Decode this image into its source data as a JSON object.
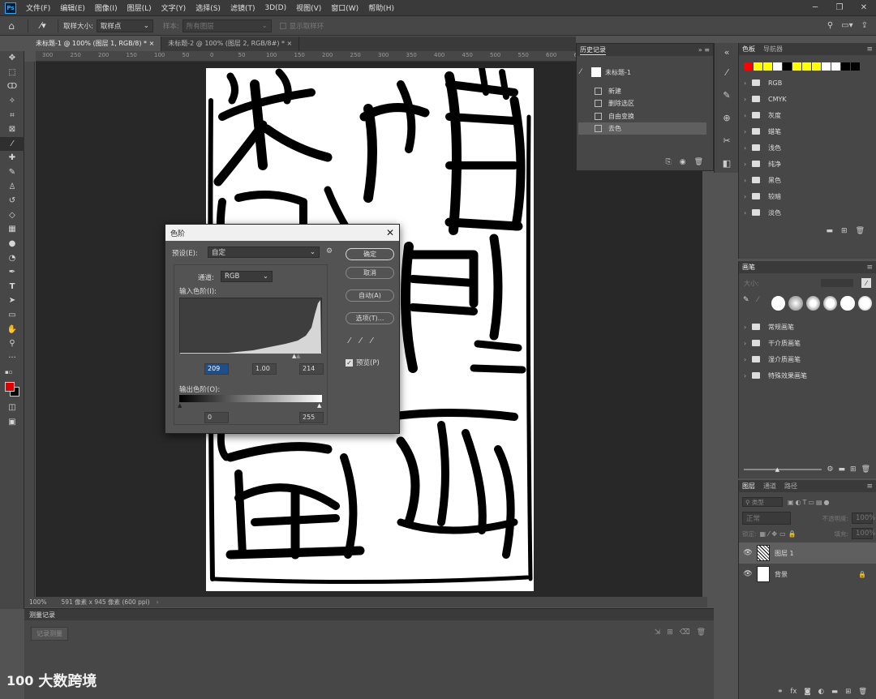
{
  "menu": {
    "logo": "Ps",
    "items": [
      "文件(F)",
      "编辑(E)",
      "图像(I)",
      "图层(L)",
      "文字(Y)",
      "选择(S)",
      "滤镜(T)",
      "3D(D)",
      "视图(V)",
      "窗口(W)",
      "帮助(H)"
    ]
  },
  "options": {
    "sample_size_label": "取样大小:",
    "sample_size_value": "取样点",
    "sample_label": "样本:",
    "sample_value": "所有图层",
    "show_ring": "显示取样环"
  },
  "tabs": [
    {
      "label": "未标题-1 @ 100% (图层 1, RGB/8) *"
    },
    {
      "label": "未标题-2 @ 100% (图层 2, RGB/8#) *"
    }
  ],
  "ruler": {
    "h_ticks": [
      "300",
      "250",
      "200",
      "150",
      "100",
      "50",
      "0",
      "50",
      "100",
      "150",
      "200",
      "250",
      "300",
      "350",
      "400",
      "450",
      "500",
      "550",
      "600",
      "650"
    ]
  },
  "status": {
    "zoom": "100%",
    "doc_info": "591 像素 x 945 像素 (600 ppi)",
    "arrow": "›"
  },
  "measure_log": {
    "title": "测量记录",
    "record_button": "记录测量"
  },
  "history": {
    "title": "历史记录",
    "snapshot": "未标题-1",
    "items": [
      {
        "label": "新建",
        "selected": false
      },
      {
        "label": "删除选区",
        "selected": false
      },
      {
        "label": "自由变换",
        "selected": false
      },
      {
        "label": "去色",
        "selected": true
      }
    ]
  },
  "swatches": {
    "tabs": [
      "色板",
      "导航器"
    ],
    "colors": [
      "#ff0000",
      "#ffff00",
      "#ffff00",
      "#ffffff",
      "#000000",
      "#ffff00",
      "#ffff00",
      "#ffff00",
      "#ffffff",
      "#ffffff",
      "#000000",
      "#000000"
    ],
    "groups": [
      "RGB",
      "CMYK",
      "灰度",
      "蜡笔",
      "浅色",
      "纯净",
      "黑色",
      "较暗",
      "淡色"
    ]
  },
  "brushes": {
    "tab": "画笔",
    "size_label": "大小:",
    "groups": [
      "常规画笔",
      "干介质画笔",
      "湿介质画笔",
      "特殊效果画笔"
    ]
  },
  "layers": {
    "tabs": [
      "图层",
      "通道",
      "路径"
    ],
    "filter_label": "类型",
    "blend_mode": "正常",
    "opacity_label": "不透明度:",
    "opacity_value": "100%",
    "lock_label": "锁定:",
    "fill_label": "填充:",
    "fill_value": "100%",
    "items": [
      {
        "name": "图层 1",
        "selected": true
      },
      {
        "name": "背景",
        "selected": false
      }
    ]
  },
  "levels": {
    "title": "色阶",
    "preset_label": "预设(E):",
    "preset_value": "自定",
    "channel_label": "通道:",
    "channel_value": "RGB",
    "input_label": "输入色阶(I):",
    "input_black": "209",
    "input_gamma": "1.00",
    "input_white": "214",
    "output_label": "输出色阶(O):",
    "output_black": "0",
    "output_white": "255",
    "ok": "确定",
    "cancel": "取消",
    "auto": "自动(A)",
    "options": "选项(T)...",
    "preview_label": "预览(P)",
    "preview_checked": true
  },
  "watermark": {
    "logo": "100",
    "text": "大数跨境"
  }
}
